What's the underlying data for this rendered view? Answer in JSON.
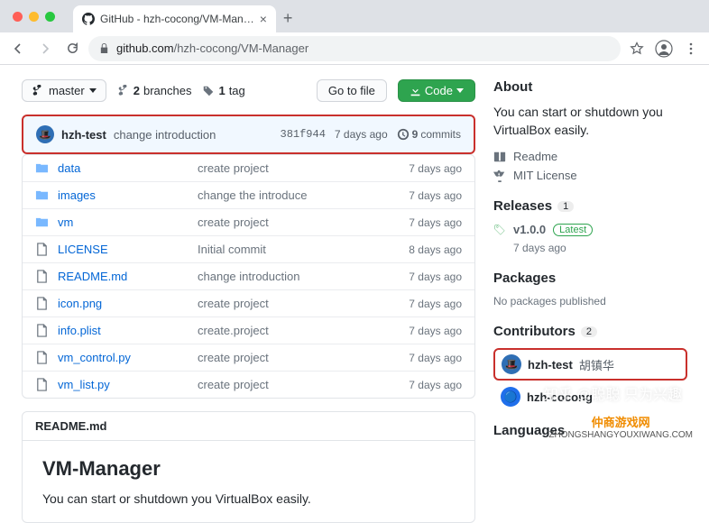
{
  "browser": {
    "tab_title": "GitHub - hzh-cocong/VM-Man…",
    "new_tab": "+",
    "url_host": "github.com",
    "url_path": "/hzh-cocong/VM-Manager"
  },
  "toolbar": {
    "branch_label": "master",
    "branches_count": "2",
    "branches_label": "branches",
    "tags_count": "1",
    "tags_label": "tag",
    "go_to_file": "Go to file",
    "code_btn": "Code"
  },
  "commit": {
    "author": "hzh-test",
    "message": "change introduction",
    "sha": "381f944",
    "time": "7 days ago",
    "commits_count": "9",
    "commits_label": "commits"
  },
  "files": [
    {
      "type": "dir",
      "name": "data",
      "msg": "create project",
      "time": "7 days ago"
    },
    {
      "type": "dir",
      "name": "images",
      "msg": "change the introduce",
      "time": "7 days ago"
    },
    {
      "type": "dir",
      "name": "vm",
      "msg": "create project",
      "time": "7 days ago"
    },
    {
      "type": "file",
      "name": "LICENSE",
      "msg": "Initial commit",
      "time": "8 days ago"
    },
    {
      "type": "file",
      "name": "README.md",
      "msg": "change introduction",
      "time": "7 days ago"
    },
    {
      "type": "file",
      "name": "icon.png",
      "msg": "create project",
      "time": "7 days ago"
    },
    {
      "type": "file",
      "name": "info.plist",
      "msg": "create.project",
      "time": "7 days ago"
    },
    {
      "type": "file",
      "name": "vm_control.py",
      "msg": "create project",
      "time": "7 days ago"
    },
    {
      "type": "file",
      "name": "vm_list.py",
      "msg": "create project",
      "time": "7 days ago"
    }
  ],
  "readme": {
    "filename": "README.md",
    "heading": "VM-Manager",
    "body": "You can start or shutdown you VirtualBox easily."
  },
  "about": {
    "heading": "About",
    "desc": "You can start or shutdown you VirtualBox easily.",
    "readme_link": "Readme",
    "license_link": "MIT License"
  },
  "releases": {
    "heading": "Releases",
    "count": "1",
    "version": "v1.0.0",
    "latest": "Latest",
    "time": "7 days ago"
  },
  "packages": {
    "heading": "Packages",
    "none": "No packages published"
  },
  "contributors": {
    "heading": "Contributors",
    "count": "2",
    "list": [
      {
        "login": "hzh-test",
        "name": "胡镇华"
      },
      {
        "login": "hzh-cocong",
        "name": ""
      }
    ]
  },
  "languages_heading": "Languages",
  "watermark1": "知乎 @聪聪  只为兴趣",
  "watermark2_brand": "仲商游戏网",
  "watermark2_url": "ZHONGSHANGYOUXIWANG.COM"
}
